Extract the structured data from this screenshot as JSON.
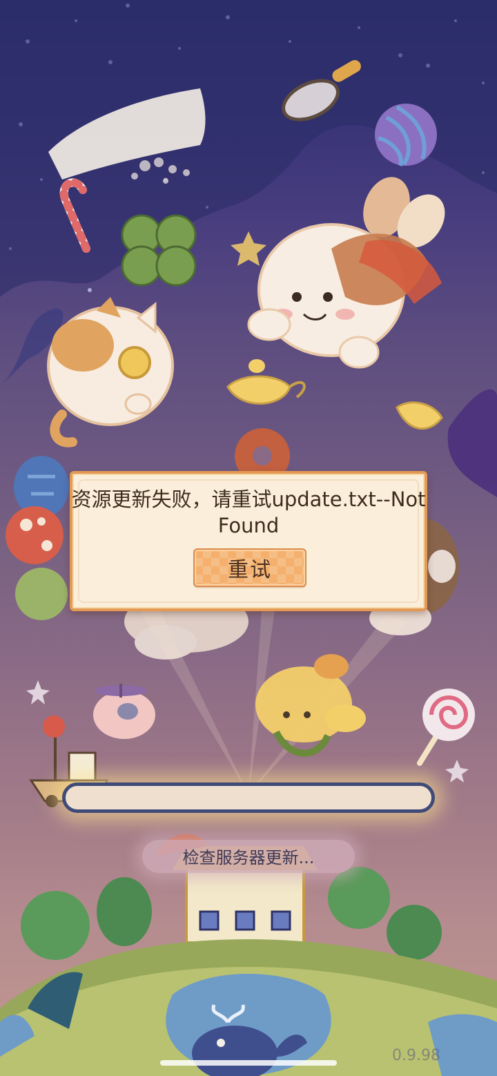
{
  "dialog": {
    "message": "资源更新失败，请重试update.txt--Not Found",
    "retry_label": "重试"
  },
  "loading": {
    "status_text": "检查服务器更新...",
    "progress": 0
  },
  "version": "0.9.98",
  "colors": {
    "dialog_background": "#fbefdb",
    "dialog_border": "#e39a55",
    "button_fill": "#f4b06c",
    "progress_border": "#3f4a78",
    "progress_track": "#eedfcf"
  },
  "icons": [
    "cat-balloon-icon",
    "bunny-character-icon",
    "magnifying-glass-icon",
    "yarn-ball-icon",
    "clover-icon",
    "candy-cane-icon",
    "genie-lamp-icon",
    "donut-icon",
    "balloons-icon",
    "lollipop-icon",
    "ship-icon",
    "whale-icon",
    "shop-building-icon",
    "pig-helicopter-icon",
    "dog-character-icon"
  ]
}
